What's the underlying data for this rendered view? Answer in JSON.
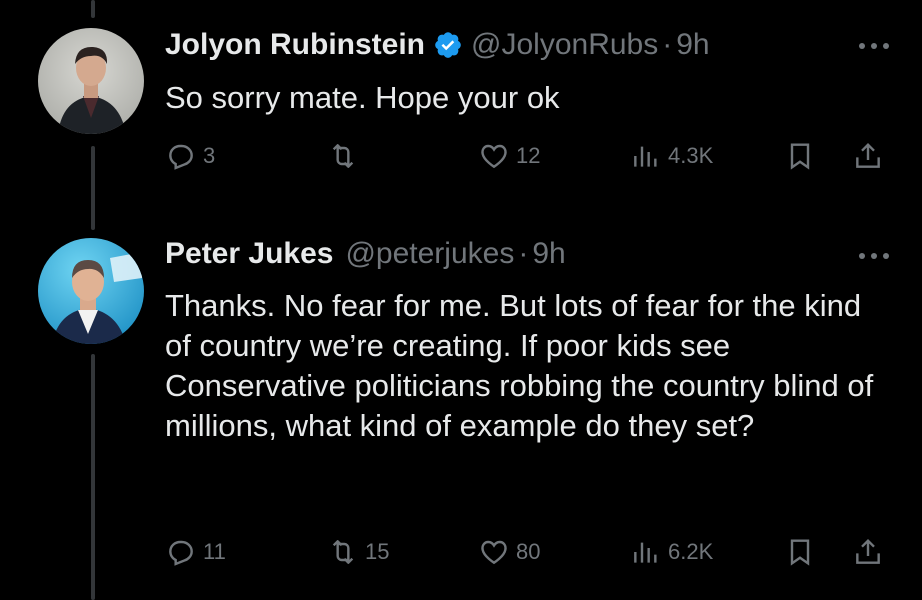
{
  "tweets": [
    {
      "name": "Jolyon Rubinstein",
      "verified": true,
      "handle": "@JolyonRubs",
      "dot": "·",
      "time": "9h",
      "text": "So sorry mate. Hope your ok",
      "replies": "3",
      "retweets": "",
      "likes": "12",
      "views": "4.3K"
    },
    {
      "name": "Peter Jukes",
      "verified": false,
      "handle": "@peterjukes",
      "dot": "·",
      "time": "9h",
      "text": "Thanks. No fear for me. But lots of fear for the kind of country we’re creating. If poor kids see Conservative politicians robbing the country blind of millions, what kind of example do they set?",
      "replies": "11",
      "retweets": "15",
      "likes": "80",
      "views": "6.2K"
    }
  ],
  "icons": {
    "reply": "reply-icon",
    "retweet": "retweet-icon",
    "like": "heart-icon",
    "views": "views-icon",
    "bookmark": "bookmark-icon",
    "share": "share-icon",
    "more": "more-icon",
    "verified": "verified-badge-icon"
  },
  "colors": {
    "background": "#000000",
    "text": "#e7e9ea",
    "muted": "#71767b",
    "verified": "#1d9bf0"
  }
}
